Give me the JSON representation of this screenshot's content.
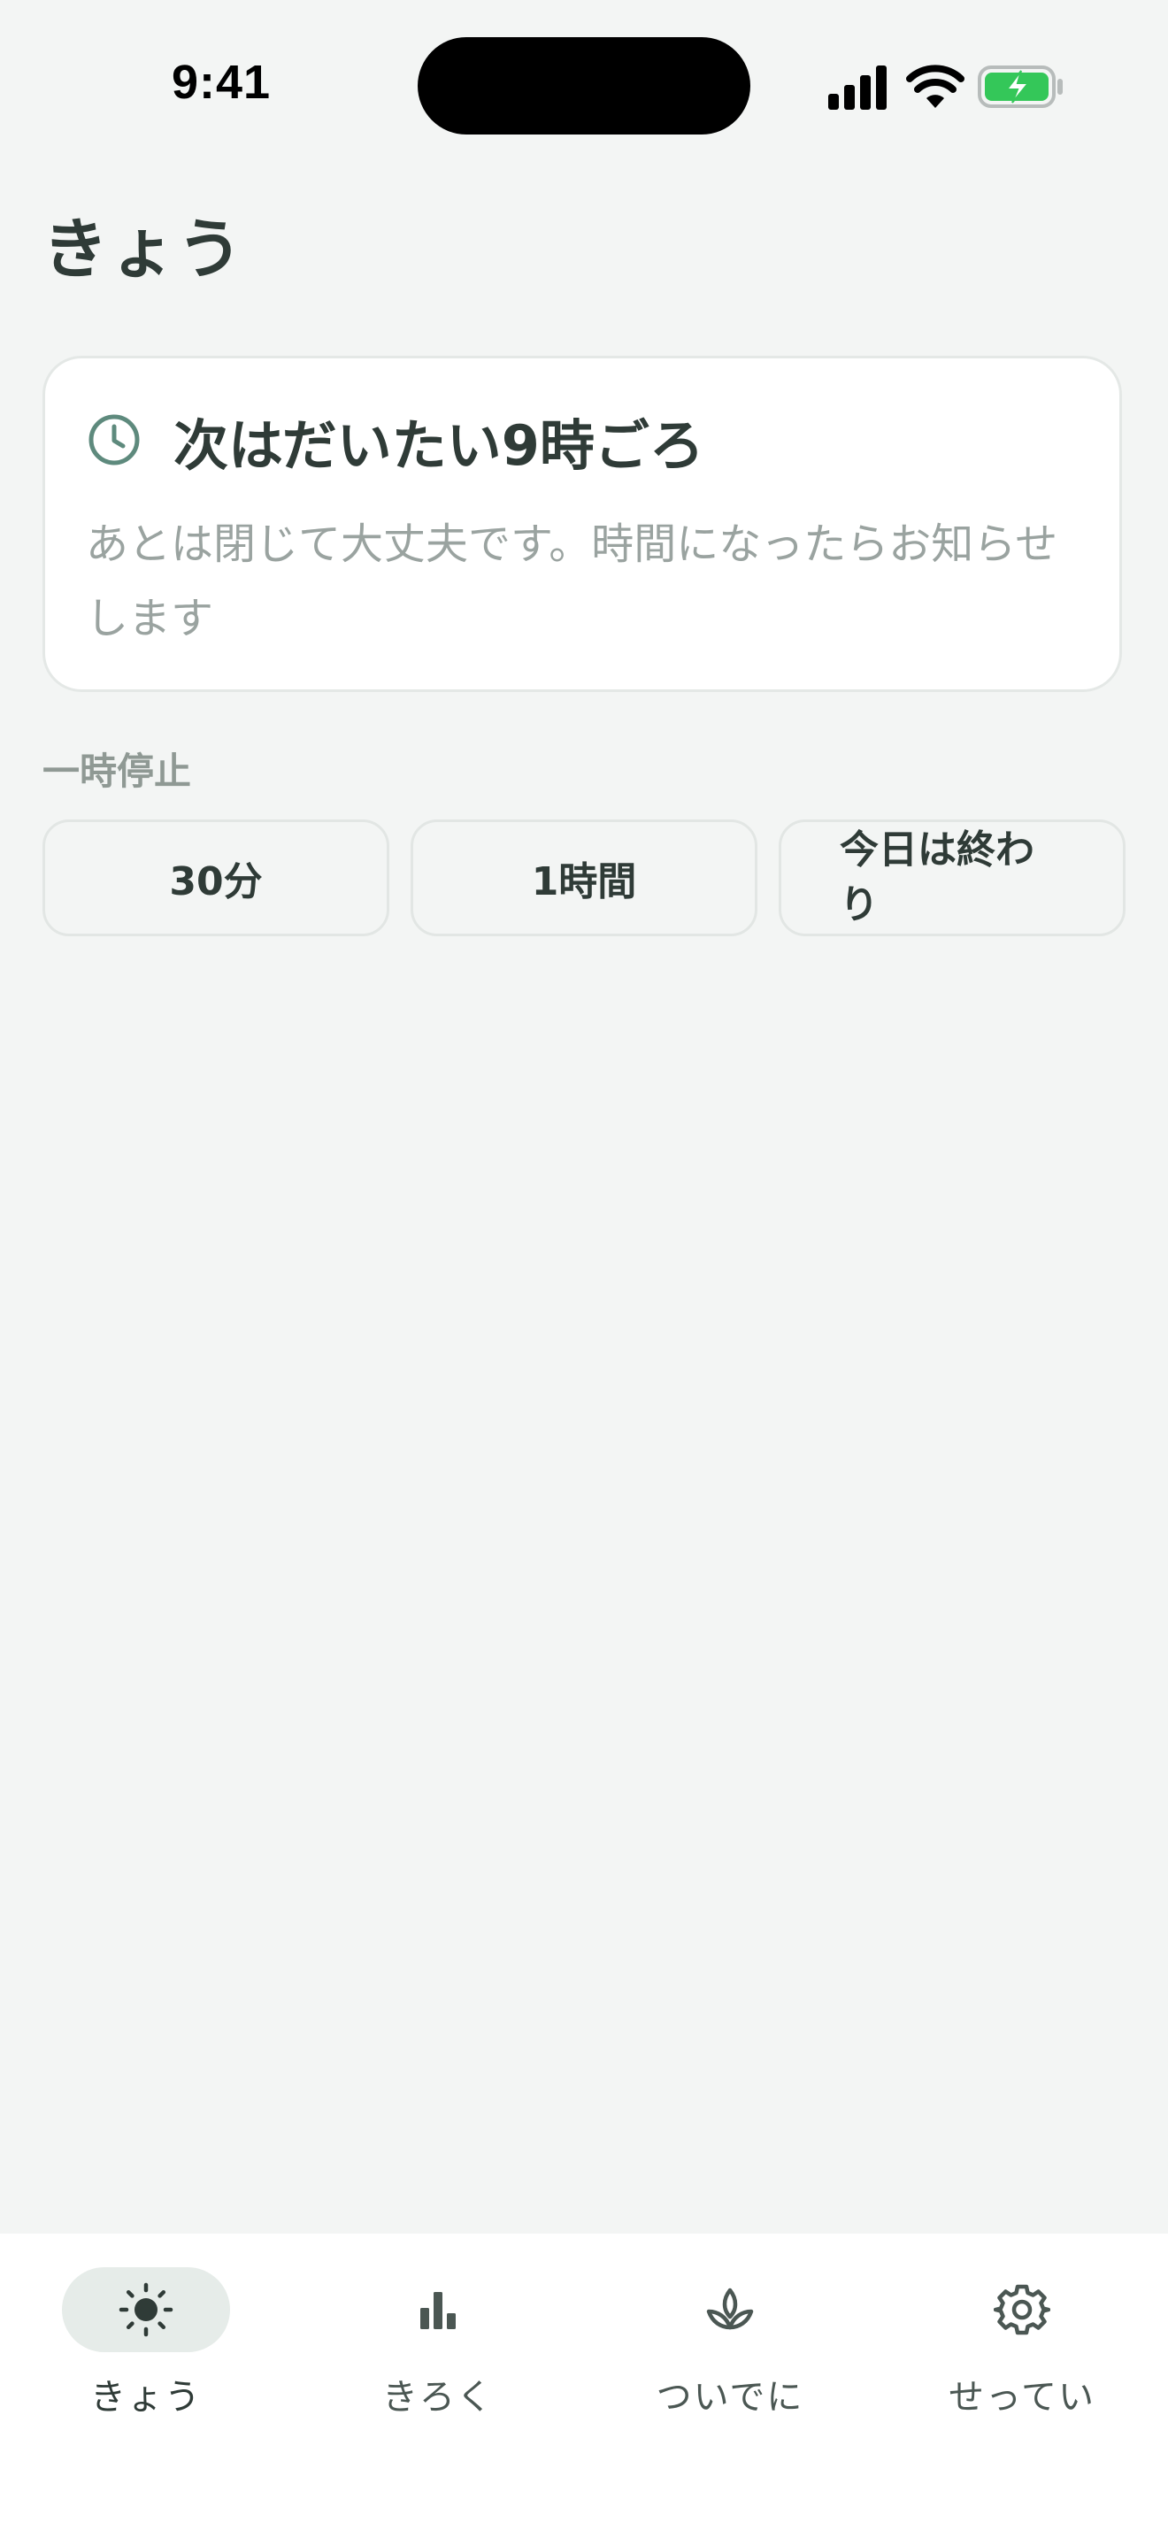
{
  "status_bar": {
    "time": "9:41",
    "icons": [
      "cellular-signal-icon",
      "wifi-icon",
      "battery-charging-icon"
    ]
  },
  "page": {
    "title": "きょう"
  },
  "next_card": {
    "icon": "clock-icon",
    "title": "次はだいたい9時ごろ",
    "body": "あとは閉じて大丈夫です。時間になったらお知らせします"
  },
  "pause": {
    "label": "一時停止",
    "options": [
      "30分",
      "1時間",
      "今日は終わり"
    ]
  },
  "tab_bar": {
    "tabs": [
      {
        "label": "きょう",
        "icon": "sun-icon",
        "active": true
      },
      {
        "label": "きろく",
        "icon": "bar-chart-icon",
        "active": false
      },
      {
        "label": "ついでに",
        "icon": "lotus-icon",
        "active": false
      },
      {
        "label": "せってい",
        "icon": "gear-icon",
        "active": false
      }
    ]
  },
  "colors": {
    "background": "#f3f5f4",
    "text_primary": "#2f3b37",
    "text_secondary": "#9aa3a0",
    "accent": "#5e8a7d",
    "battery": "#34c759",
    "active_pill": "#e6ece9"
  }
}
